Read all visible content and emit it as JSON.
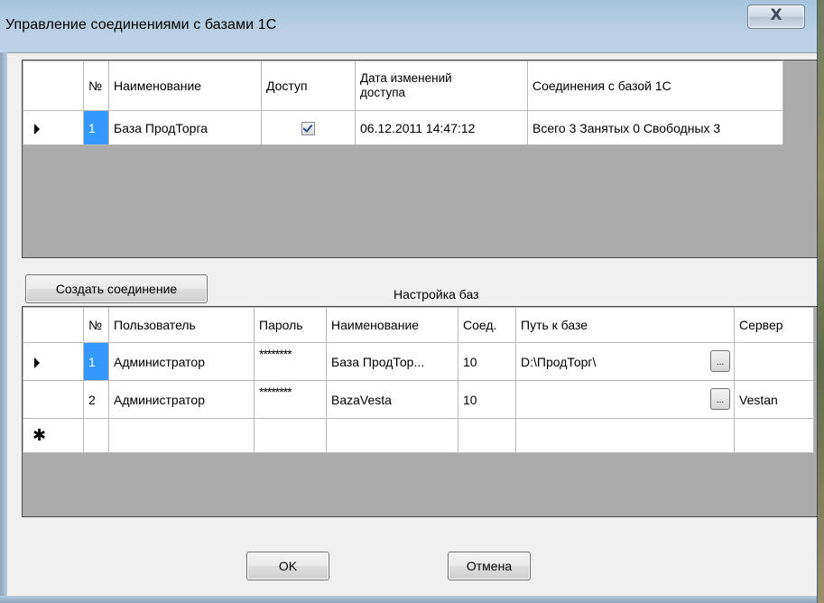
{
  "window": {
    "title": "Управление соединениями с базами 1С",
    "close_glyph": "X"
  },
  "connections_grid": {
    "headers": [
      "№",
      "Наименование",
      "Доступ",
      "Дата изменений доступа",
      "Соединения с базой 1С"
    ],
    "header_date_line1": "Дата изменений",
    "header_date_line2": "доступа",
    "rows": [
      {
        "num": "1",
        "name": "База ПродТорга",
        "access": true,
        "date": "06.12.2011 14:47:12",
        "connections": "Всего 3  Занятых 0  Свободных 3"
      }
    ]
  },
  "create_button": "Создать соединение",
  "settings_label": "Настройка баз",
  "settings_grid": {
    "headers": [
      "№",
      "Пользователь",
      "Пароль",
      "Наименование",
      "Соед.",
      "Путь к базе",
      "Сервер"
    ],
    "rows": [
      {
        "num": "1",
        "user": "Администратор",
        "password": "********",
        "name": "База ПродТор...",
        "conn": "10",
        "path": "D:\\ПродТорг\\",
        "server": ""
      },
      {
        "num": "2",
        "user": "Администратор",
        "password": "********",
        "name": "BazaVesta",
        "conn": "10",
        "path": "",
        "server": "Vestan"
      }
    ],
    "new_row_marker": "✱",
    "ellipsis": "..."
  },
  "ok_button": "OK",
  "cancel_button": "Отмена",
  "colors": {
    "selection": "#3399ff",
    "grid_background": "#ababab"
  }
}
